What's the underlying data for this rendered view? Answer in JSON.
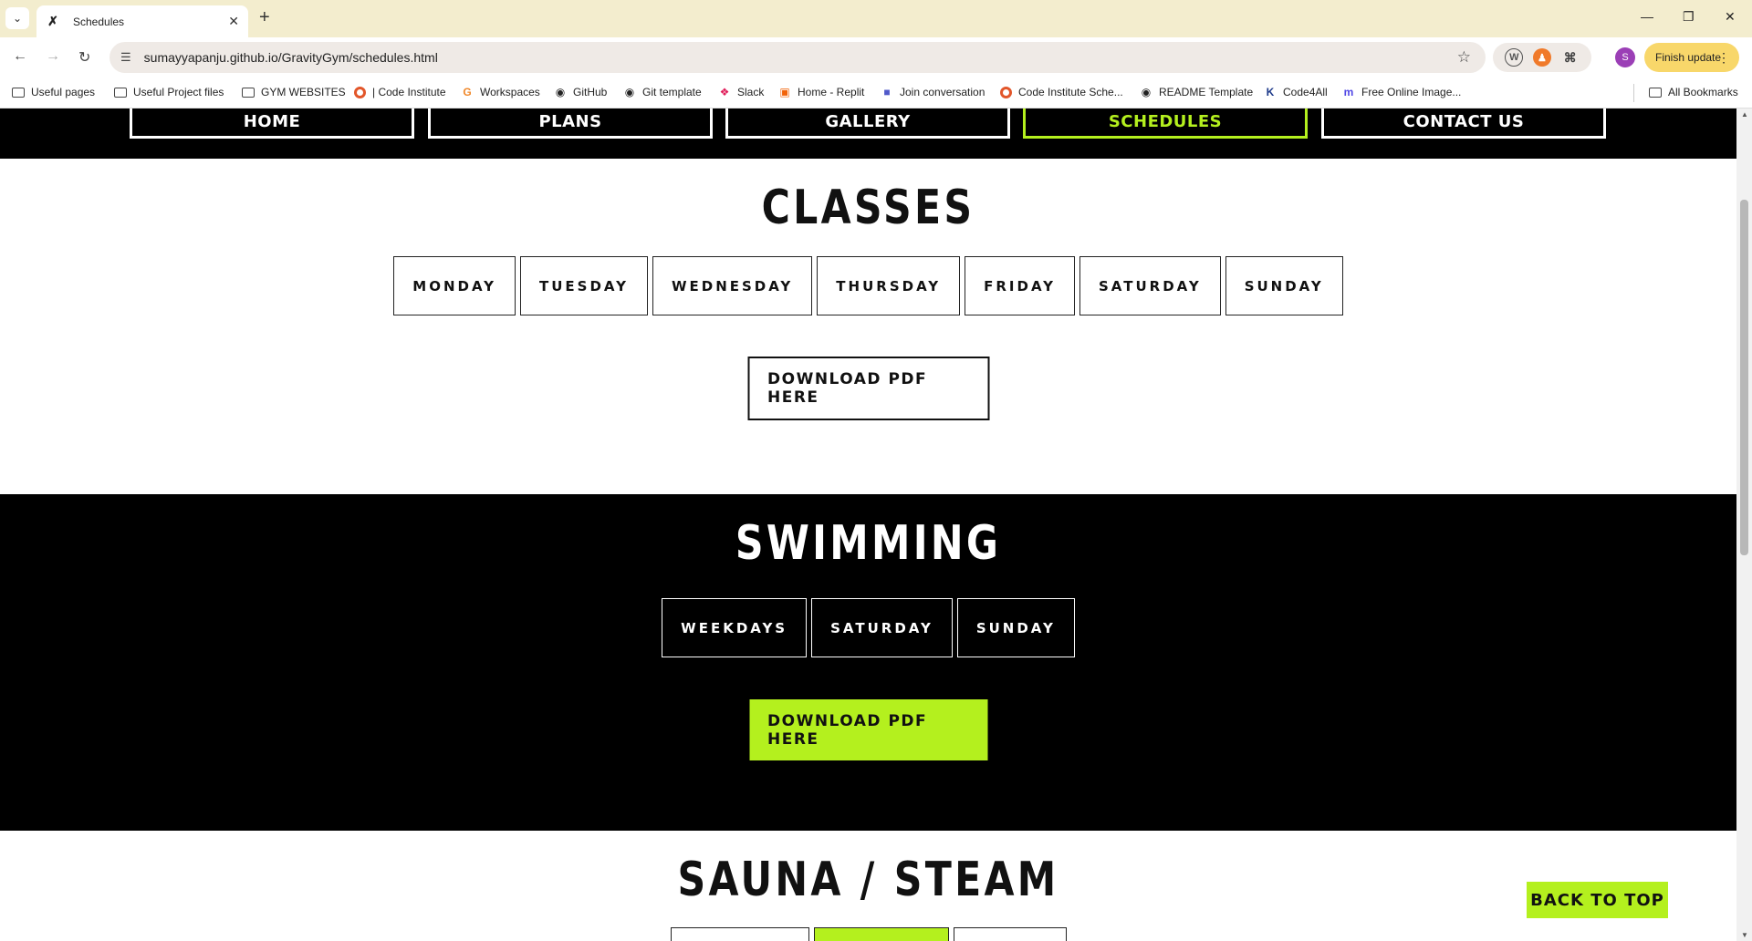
{
  "browser": {
    "tab_title": "Schedules",
    "url": "sumayyapanju.github.io/GravityGym/schedules.html",
    "finish_update_label": "Finish update",
    "profile_initial": "S",
    "bookmarks": [
      {
        "label": "Useful pages",
        "icon": "folder-icon"
      },
      {
        "label": "Useful Project files",
        "icon": "folder-icon"
      },
      {
        "label": "GYM WEBSITES",
        "icon": "folder-icon"
      },
      {
        "label": "| Code Institute",
        "icon": "code-institute-icon"
      },
      {
        "label": "Workspaces",
        "icon": "gitpod-icon"
      },
      {
        "label": "GitHub",
        "icon": "github-icon"
      },
      {
        "label": "Git template",
        "icon": "github-icon"
      },
      {
        "label": "Slack",
        "icon": "slack-icon"
      },
      {
        "label": "Home - Replit",
        "icon": "replit-icon"
      },
      {
        "label": "Join conversation",
        "icon": "teams-icon"
      },
      {
        "label": "Code Institute Sche...",
        "icon": "code-institute-icon"
      },
      {
        "label": "README Template",
        "icon": "github-icon"
      },
      {
        "label": "Code4All",
        "icon": "k-icon"
      },
      {
        "label": "Free Online Image...",
        "icon": "image-tool-icon"
      }
    ],
    "all_bookmarks_label": "All Bookmarks"
  },
  "nav": {
    "items": [
      "HOME",
      "PLANS",
      "GALLERY",
      "SCHEDULES",
      "CONTACT US"
    ],
    "active": "SCHEDULES",
    "accent_color": "#b4f01e"
  },
  "classes": {
    "title": "CLASSES",
    "days": [
      "MONDAY",
      "TUESDAY",
      "WEDNESDAY",
      "THURSDAY",
      "FRIDAY",
      "SATURDAY",
      "SUNDAY"
    ],
    "download_label": "DOWNLOAD PDF HERE"
  },
  "swimming": {
    "title": "SWIMMING",
    "days": [
      "WEEKDAYS",
      "SATURDAY",
      "SUNDAY"
    ],
    "download_label": "DOWNLOAD PDF HERE"
  },
  "sauna": {
    "title": "SAUNA / STEAM"
  },
  "back_to_top_label": "BACK TO TOP"
}
